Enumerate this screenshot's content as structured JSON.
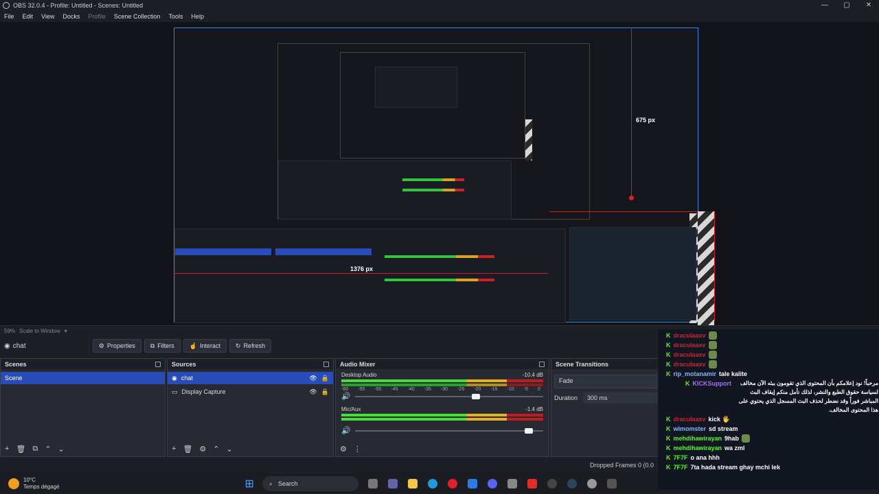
{
  "window": {
    "title": "OBS 32.0.4 - Profile: Untitled - Scenes: Untitled",
    "controls": [
      "—",
      "▢",
      "✕"
    ]
  },
  "menu": [
    "File",
    "Edit",
    "View",
    "Docks",
    "Profile",
    "Scene Collection",
    "Tools",
    "Help"
  ],
  "preview": {
    "measure_v": "675 px",
    "measure_h": "1376 px"
  },
  "zoom": {
    "level": "59%",
    "mode": "Scale to Window"
  },
  "source_toolbar": {
    "current_source": "chat",
    "properties": "Properties",
    "filters": "Filters",
    "interact": "Interact",
    "refresh": "Refresh"
  },
  "docks": {
    "scenes": {
      "title": "Scenes",
      "items": [
        "Scene"
      ]
    },
    "sources": {
      "title": "Sources",
      "items": [
        "chat",
        "Display Capture"
      ]
    },
    "audio_mixer": {
      "title": "Audio Mixer",
      "channels": [
        {
          "name": "Desktop Audio",
          "db": "-10.4 dB",
          "level": 0.82,
          "volume": 0.62
        },
        {
          "name": "Mic/Aux",
          "db": "-1.4 dB",
          "level": 0.78,
          "volume": 0.9
        }
      ],
      "scale": [
        "-60",
        "-55",
        "-50",
        "-45",
        "-40",
        "-35",
        "-30",
        "-25",
        "-20",
        "-15",
        "-10",
        "-5",
        "0"
      ]
    },
    "transitions": {
      "title": "Scene Transitions",
      "type": "Fade",
      "duration_label": "Duration",
      "duration_value": "300 ms"
    }
  },
  "status": {
    "dropped_frames": "Dropped Frames 0 (0.0"
  },
  "taskbar": {
    "temp": "10°C",
    "weather": "Temps dégagé",
    "search": "Search"
  },
  "chat": [
    {
      "user": "draculaaxv",
      "color": "red",
      "text": "",
      "emote": true
    },
    {
      "user": "draculaaxv",
      "color": "red",
      "text": "",
      "emote": true
    },
    {
      "user": "draculaaxv",
      "color": "red",
      "text": "",
      "emote": true
    },
    {
      "user": "draculaaxv",
      "color": "red",
      "text": "",
      "emote": true
    },
    {
      "user": "rip_motanamir",
      "color": "blue",
      "text": "tale kalite",
      "emote": false
    },
    {
      "user": "KICKSupport",
      "color": "purple",
      "text": "مرحباً! نود إعلامكم بأن المحتوى الذي تقومون ببثه الآن مخالف لسياسة حقوق الطبع والنشر، لذلك نأمل منكم إيقاف البث المباشر فوراً وقد نضطر لحذف البث المسجل الذي يحتوي على هذا المحتوى المخالف.",
      "emote": false
    },
    {
      "user": "draculaaxv",
      "color": "red",
      "text": "kick 🖐",
      "emote": false
    },
    {
      "user": "wlmomster",
      "color": "blue",
      "text": "sd stream",
      "emote": false
    },
    {
      "user": "mehdihawirayan",
      "color": "green",
      "text": "9hab",
      "emote": true
    },
    {
      "user": "mehdihawirayan",
      "color": "green",
      "text": "wa zml",
      "emote": false
    },
    {
      "user": "7F7F",
      "color": "green",
      "text": "o ana hhh",
      "emote": false
    },
    {
      "user": "7F7F",
      "color": "green",
      "text": "7ta hada stream ghay mchi lek",
      "emote": false
    }
  ],
  "colors": {
    "accent": "#284cb8",
    "preview_border": "#2c88e6",
    "guide_red": "#d21e1e",
    "kick_green": "#53fc18"
  }
}
